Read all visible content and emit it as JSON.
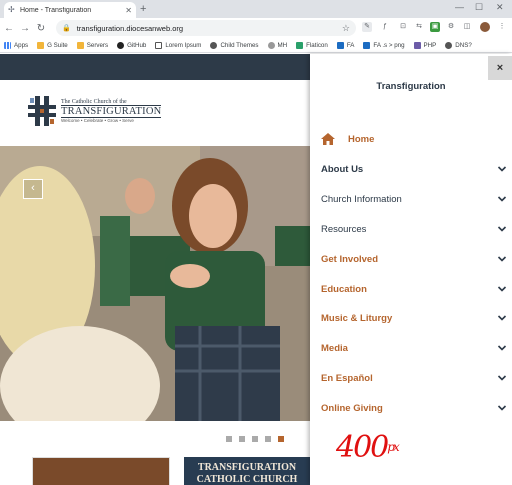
{
  "browser": {
    "tab_title": "Home - Transfiguration",
    "new_tab": "+",
    "url": "transfiguration.diocesanweb.org",
    "bookmarks": [
      "Apps",
      "G Suite",
      "Servers",
      "GitHub",
      "Lorem Ipsum",
      "Child Themes",
      "MH",
      "Flaticon",
      "FA",
      "FA .s > png",
      "PHP",
      "DNS?"
    ]
  },
  "site": {
    "logo_small": "The Catholic Church of the",
    "logo_big": "TRANSFIGURATION",
    "logo_tagline": "Welcome • Celebrate • Grow • Serve",
    "thumb2_line1": "TRANSFIGURATION",
    "thumb2_line2": "CATHOLIC CHURCH"
  },
  "drawer": {
    "title": "Transfiguration",
    "close": "×",
    "items": [
      {
        "label": "Home",
        "color": "#b5652e",
        "bold": true
      },
      {
        "label": "About Us",
        "color": "#2d3a48",
        "bold": true
      },
      {
        "label": "Church Information",
        "color": "#2d3a48",
        "bold": false
      },
      {
        "label": "Resources",
        "color": "#2d3a48",
        "bold": false
      },
      {
        "label": "Get Involved",
        "color": "#b5652e",
        "bold": true
      },
      {
        "label": "Education",
        "color": "#b5652e",
        "bold": true
      },
      {
        "label": "Music & Liturgy",
        "color": "#b5652e",
        "bold": true
      },
      {
        "label": "Media",
        "color": "#b5652e",
        "bold": true
      },
      {
        "label": "En Español",
        "color": "#b5652e",
        "bold": true
      },
      {
        "label": "Online Giving",
        "color": "#b5652e",
        "bold": true
      }
    ]
  },
  "annotation": {
    "value": "400",
    "unit": "px"
  },
  "colors": {
    "accent": "#b5652e",
    "navy": "#2d3a48"
  }
}
